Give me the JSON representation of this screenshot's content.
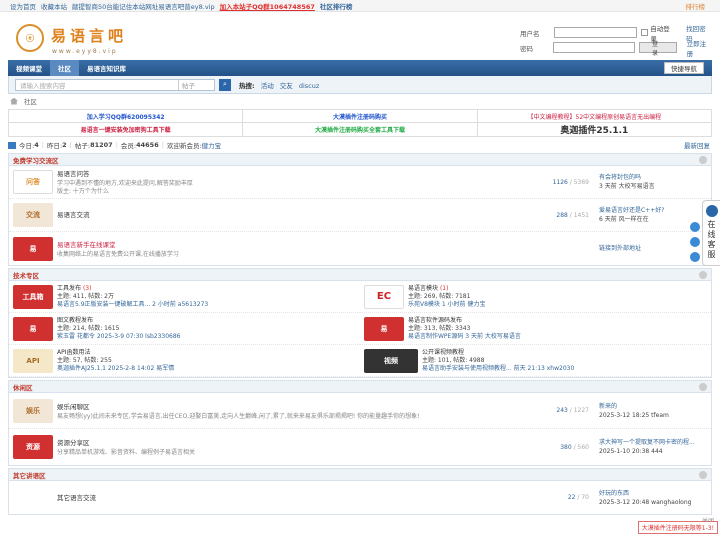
{
  "topbar": {
    "sethome": "设为首页",
    "fav": "收藏本站",
    "notice": "献提智商50台能记住本站网址易语言吧普ey8.vip",
    "qq": "加入本站子QQ群1064748567",
    "rank": "社区排行榜",
    "style": "排行榜"
  },
  "logo": {
    "cn": "易语言吧",
    "url": "www.eyy8.vip",
    "mark": "ⓔ"
  },
  "login": {
    "user_label": "用户名",
    "pass_label": "密码",
    "auto": "自动登录",
    "find": "找回密码",
    "login_btn": "登录",
    "register": "立即注册"
  },
  "nav": {
    "items": [
      "视频课堂",
      "社区",
      "易语言知识库"
    ],
    "quick": "快捷导航"
  },
  "search": {
    "placeholder": "请输入搜索内容",
    "scope": "帖子",
    "hot_label": "热搜:",
    "hot": [
      "活动",
      "交友",
      "discuz"
    ]
  },
  "crumb": {
    "current": "社区"
  },
  "ads": [
    [
      {
        "text": "加入学习QQ群620095342",
        "color": "#2255cc"
      },
      {
        "text": "大漠插件注册码购买",
        "color": "#2255cc"
      },
      {
        "text": "【中文编程教程】52中文编程原创易语言无出编程",
        "color": "#cc2244"
      }
    ],
    [
      {
        "text": "易语言一键安装免加密狗工具下载",
        "color": "#cc2244"
      },
      {
        "text": "大漠插件注册码购买全套工具下载",
        "color": "#22aa44"
      },
      {
        "text": "奥迦插件25.1.1",
        "color": "#333333"
      }
    ]
  ],
  "stats": {
    "today_l": "今日:",
    "today": "4",
    "yest_l": "昨日:",
    "yest": "2",
    "posts_l": "帖子:",
    "posts": "81207",
    "members_l": "会员:",
    "members": "44656",
    "welcome": "欢迎新会员:",
    "newmember": "健力宝",
    "latest": "最新回复"
  },
  "sections": [
    {
      "title": "免费学习交流区",
      "forums": [
        {
          "icon": "问答",
          "color": "#e09030",
          "title": "易语言问答",
          "desc": "学习中遇到不懂的地方,欢迎来此提问,解答奖励丰厚",
          "mod": "版主: 十万个为什么",
          "count": "1126",
          "total": "5369",
          "last": "有会将封包的吗",
          "lastinfo": "3 天前 大校写易语言"
        },
        {
          "icon": "交流",
          "color": "#c08040",
          "title": "易语言交流",
          "desc": "",
          "mod": "",
          "count": "288",
          "total": "1451",
          "last": "爱易语言好还是C++好?",
          "lastinfo": "6 天前 风一样在在"
        },
        {
          "icon": "易",
          "color": "#d03030",
          "title": "易语言新手在线课堂",
          "desc": "收集网络上的易语言免费公开课,在线播放学习",
          "mod": "",
          "count": "",
          "total": "",
          "last": "链接到外部地址",
          "lastinfo": ""
        }
      ]
    },
    {
      "title": "技术专区",
      "cells": [
        {
          "icon": "工具箱",
          "color": "#d03030",
          "title": "工具发布",
          "extra": "(3)",
          "l1": "主题: 411, 帖数: 2万",
          "l2": "易语言5.9正版安装一键破解工具... 2 小时前 a5613273"
        },
        {
          "icon": "EC",
          "color": "#cc2222",
          "title": "易语言模块",
          "extra": "(1)",
          "l1": "主题: 269, 帖数: 7181",
          "l2": "乐苑V8模块 1 小时前 健力宝"
        },
        {
          "icon": "易",
          "color": "#d03030",
          "title": "图文教程发布",
          "extra": "",
          "l1": "主题: 214, 帖数: 1615",
          "l2": "紫玉雷 花都令 2025-3-9 07:30 lsb2330686"
        },
        {
          "icon": "易",
          "color": "#d03030",
          "title": "易语言软件源码发布",
          "extra": "",
          "l1": "主题: 313, 帖数: 3343",
          "l2": "易语言制作WPE源码 3 天前 大校写易语言"
        },
        {
          "icon": "API",
          "color": "#c09030",
          "title": "API函数用法",
          "extra": "",
          "l1": "主题: 57, 帖数: 255",
          "l2": "奥迦插件AJ25.1.1 2025-2-8 14:02 易军情"
        },
        {
          "icon": "视频",
          "color": "#555555",
          "title": "公开课视频教程",
          "extra": "",
          "l1": "主题: 101, 帖数: 4988",
          "l2": "易语言助手安装与使用视频教程... 前天 21:13 xhw2030"
        }
      ]
    },
    {
      "title": "休闲区",
      "forums": [
        {
          "icon": "娱乐",
          "color": "#c08040",
          "title": "娱乐闲聊区",
          "desc": "易友畅想(yy)此间未来专区,学会易语言,出任CEO,迎娶白富美,走向人生巅峰,闲了,累了,就来来易友俱乐部揭揭吧! 你的能量趣手你的想象!",
          "mod": "",
          "count": "243",
          "total": "1227",
          "last": "新来的",
          "lastinfo": "2025-3-12 18:25 tfeam"
        },
        {
          "icon": "资源",
          "color": "#d03030",
          "title": "资源分享区",
          "desc": "分享精品单机游戏、影音资料、编程例子易语言相关",
          "mod": "",
          "count": "380",
          "total": "560",
          "last": "求大神写一个提取复不网卡密的程...",
          "lastinfo": "2025-1-10 20:38 444"
        }
      ]
    },
    {
      "title": "其它讲语区",
      "forums": [
        {
          "icon": "",
          "color": "#ffffff",
          "title": "其它语言交流",
          "desc": "",
          "mod": "",
          "count": "22",
          "total": "70",
          "last": "好玩的东西",
          "lastinfo": "2025-3-12 20:48 wanghaolong"
        }
      ]
    }
  ],
  "float": {
    "service": "在线客服"
  },
  "toast": {
    "text": "大漠插件注册码无限等1-3!",
    "close": "关闭"
  }
}
